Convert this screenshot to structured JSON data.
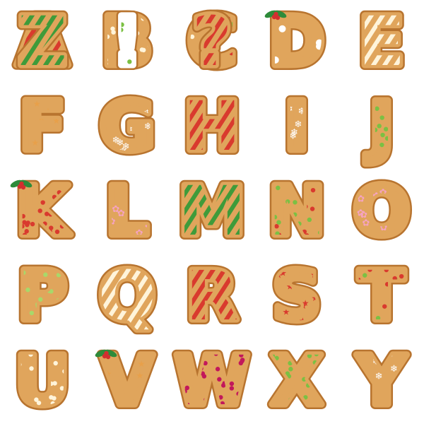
{
  "title": "",
  "glyphs": [
    {
      "char": "A",
      "pattern": "stripes",
      "stripe": "#d93a2e",
      "icing": "#ffffff"
    },
    {
      "char": "B",
      "pattern": "outline-dots",
      "dot": "#fff4da"
    },
    {
      "char": "C",
      "pattern": "dots",
      "dots": [
        "#7bc043",
        "#fff4da",
        "#d93a2e"
      ]
    },
    {
      "char": "D",
      "pattern": "holes",
      "holly": true
    },
    {
      "char": "E",
      "pattern": "stripes",
      "stripe": "#fff4da",
      "icing": "#fff4da"
    },
    {
      "char": "F",
      "pattern": "stars",
      "star": "#e8a04a"
    },
    {
      "char": "G",
      "pattern": "snowflakes",
      "flake": "#ffffff"
    },
    {
      "char": "H",
      "pattern": "stripes",
      "stripe": "#d93a2e",
      "icing": "#ffffff"
    },
    {
      "char": "I",
      "pattern": "snowflakes",
      "flake": "#ffffff"
    },
    {
      "char": "J",
      "pattern": "outline-dots",
      "dot": "#7bc043"
    },
    {
      "char": "K",
      "pattern": "dots",
      "dots": [
        "#d93a2e"
      ],
      "holly": true
    },
    {
      "char": "L",
      "pattern": "flowers",
      "flower": "#f5a3c0"
    },
    {
      "char": "M",
      "pattern": "stripes",
      "stripe": "#3f9b3a",
      "icing": "#b6e07a"
    },
    {
      "char": "N",
      "pattern": "dots",
      "dots": [
        "#d93a2e",
        "#7bc043"
      ]
    },
    {
      "char": "O",
      "pattern": "flowers",
      "flower": "#f5a3c0"
    },
    {
      "char": "P",
      "pattern": "outline-dots",
      "dot": "#a8d86a"
    },
    {
      "char": "Q",
      "pattern": "stripes",
      "stripe": "#fff4da",
      "icing": "#fff4da"
    },
    {
      "char": "R",
      "pattern": "stripes",
      "stripe": "#d93a2e",
      "icing": "#ffffff"
    },
    {
      "char": "S",
      "pattern": "stars",
      "star": "#d93a2e"
    },
    {
      "char": "T",
      "pattern": "dots",
      "dots": [
        "#7bc043",
        "#d93a2e"
      ]
    },
    {
      "char": "U",
      "pattern": "outline-dots",
      "dot": "#fff4da"
    },
    {
      "char": "V",
      "pattern": "stars",
      "star": "#e8a04a",
      "holly": true
    },
    {
      "char": "W",
      "pattern": "dots",
      "dots": [
        "#c2185b"
      ]
    },
    {
      "char": "X",
      "pattern": "outline-dots",
      "dot": "#7bc043"
    },
    {
      "char": "Y",
      "pattern": "snowflakes",
      "flake": "#ffffff"
    },
    {
      "char": "Z",
      "pattern": "stripes",
      "stripe": "#3f9b3a",
      "icing": "#b6e07a"
    },
    {
      "char": "!",
      "pattern": "outline-dots",
      "dot": "#7bc043",
      "fill": "#ffffff"
    },
    {
      "char": "?",
      "pattern": "stripes",
      "stripe": "#d93a2e",
      "icing": "#ffffff"
    }
  ],
  "colors": {
    "cookie": "#e0a55c",
    "cookie_edge": "#b8742f",
    "holly_leaf": "#2e8b3a",
    "berry": "#d32f2f"
  }
}
